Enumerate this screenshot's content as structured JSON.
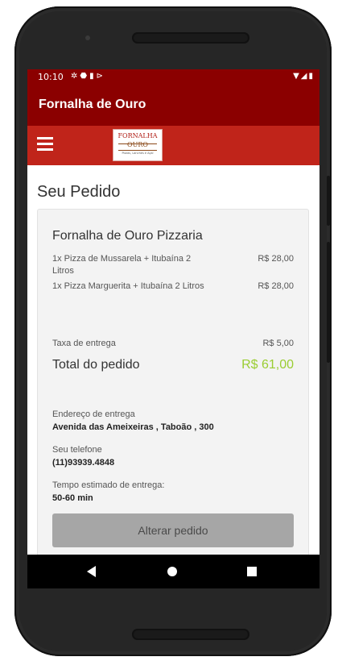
{
  "status_bar": {
    "time": "10:10",
    "left_icons": [
      "settings-icon",
      "shield-icon",
      "sd-card-icon",
      "flag-icon"
    ],
    "right_icons": [
      "wifi-icon",
      "signal-icon",
      "battery-icon"
    ]
  },
  "app_bar": {
    "title": "Fornalha de Ouro"
  },
  "nav": {
    "logo": {
      "line1": "FORNALHA",
      "line2": "OURO",
      "line3": "Pizzas, Lanches e Açaí"
    }
  },
  "order": {
    "page_title": "Seu Pedido",
    "store_name": "Fornalha de Ouro Pizzaria",
    "items": [
      {
        "description": "1x Pizza de Mussarela + Itubaína 2 Litros",
        "price": "R$ 28,00"
      },
      {
        "description": "1x Pizza Marguerita + Itubaína 2 Litros",
        "price": "R$ 28,00"
      }
    ],
    "delivery_fee_label": "Taxa de entrega",
    "delivery_fee_value": "R$ 5,00",
    "total_label": "Total do pedido",
    "total_value": "R$ 61,00",
    "address_label": "Endereço de entrega",
    "address_value": "Avenida das Ameixeiras , Taboão , 300",
    "phone_label": "Seu telefone",
    "phone_value": "(11)93939.4848",
    "eta_label": "Tempo estimado de entrega:",
    "eta_value": "50-60 min",
    "change_button": "Alterar pedido"
  },
  "colors": {
    "primary_dark": "#8b0000",
    "primary": "#c0241a",
    "total_accent": "#9acd32"
  }
}
